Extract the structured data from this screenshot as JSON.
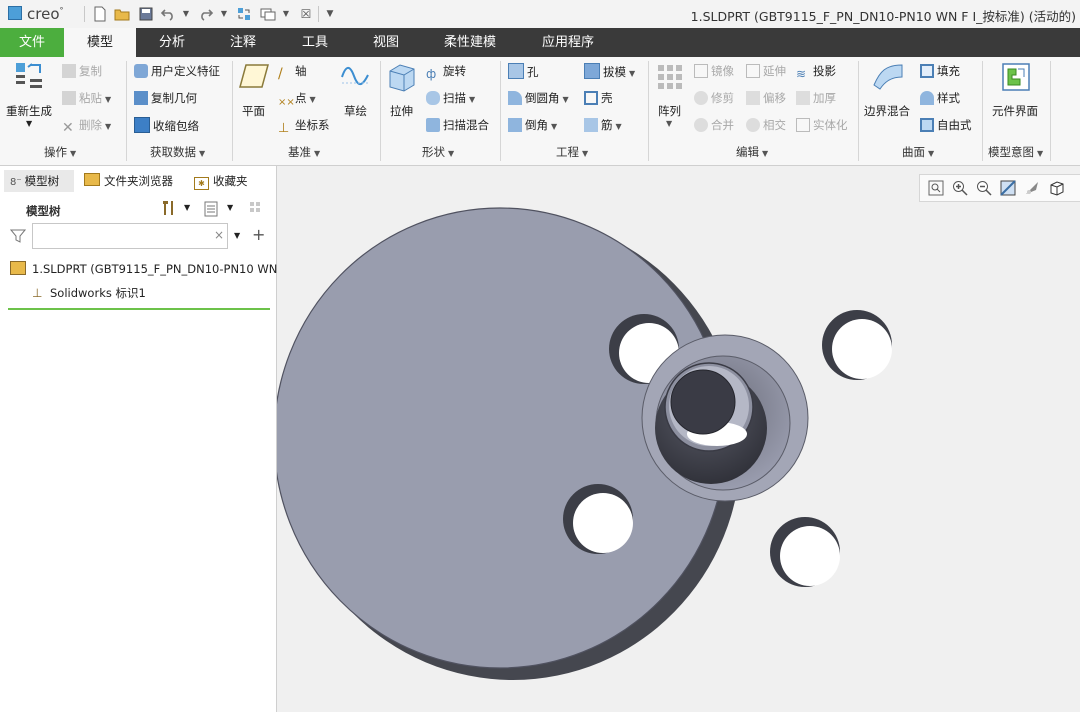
{
  "app": {
    "logo": "creo",
    "logo_mark": "°"
  },
  "window": {
    "title": "1.SLDPRT (GBT9115_F_PN_DN10-PN10 WN F I_按标准) (活动的)"
  },
  "quick_access": {
    "icons": [
      "new-icon",
      "open-icon",
      "save-icon",
      "undo-icon",
      "redo-icon",
      "regenerate-icon",
      "windows-icon",
      "close-icon",
      "customize-icon"
    ]
  },
  "ribbon": {
    "tabs": [
      "文件",
      "模型",
      "分析",
      "注释",
      "工具",
      "视图",
      "柔性建模",
      "应用程序"
    ],
    "active_tab": "模型",
    "groups": {
      "operations": {
        "label": "操作",
        "regenerate": "重新生成",
        "copy": "复制",
        "paste": "粘贴",
        "delete": "删除"
      },
      "get_data": {
        "label": "获取数据",
        "udf": "用户定义特征",
        "copy_geom": "复制几何",
        "shrinkwrap": "收缩包络"
      },
      "datum": {
        "label": "基准",
        "plane": "平面",
        "axis": "轴",
        "point": "点",
        "csys": "坐标系",
        "sketch": "草绘"
      },
      "shapes": {
        "label": "形状",
        "extrude": "拉伸",
        "revolve": "旋转",
        "sweep": "扫描",
        "swept_blend": "扫描混合"
      },
      "engineering": {
        "label": "工程",
        "hole": "孔",
        "round": "倒圆角",
        "chamfer": "倒角",
        "draft": "拔模",
        "shell": "壳",
        "rib": "筋"
      },
      "editing": {
        "label": "编辑",
        "pattern": "阵列",
        "mirror": "镜像",
        "extend": "延伸",
        "project": "投影",
        "trim": "修剪",
        "offset": "偏移",
        "thicken": "加厚",
        "merge": "合并",
        "intersect": "相交",
        "solidify": "实体化"
      },
      "surfaces": {
        "label": "曲面",
        "boundary_blend": "边界混合",
        "fill": "填充",
        "style": "样式",
        "freestyle": "自由式"
      },
      "model_intent": {
        "label": "模型意图",
        "component_interface": "元件界面"
      }
    }
  },
  "left_panel": {
    "tabs": [
      "模型树",
      "文件夹浏览器",
      "收藏夹"
    ],
    "tree_title": "模型树",
    "filter_placeholder": "",
    "items": [
      {
        "label": "1.SLDPRT (GBT9115_F_PN_DN10-PN10 WN",
        "icon": "part-icon"
      },
      {
        "label": "Solidworks 标识1",
        "icon": "csys-icon"
      }
    ]
  },
  "graphics": {
    "view_toolbar": [
      "refit-icon",
      "zoom-in-icon",
      "zoom-out-icon",
      "reorient-icon",
      "saved-views-icon",
      "display-style-icon"
    ],
    "model": "flange",
    "colors": {
      "face": "#999daf",
      "side": "#454750",
      "hole": "#ffffff",
      "neck_dark": "#3a3b45"
    }
  }
}
